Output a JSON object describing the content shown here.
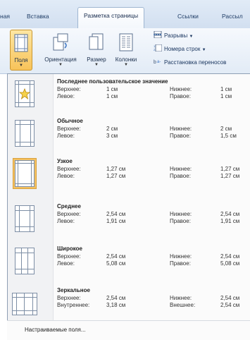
{
  "tabs": [
    "ная",
    "Вставка",
    "Разметка страницы",
    "Ссылки",
    "Рассыл"
  ],
  "ribbon": {
    "margins_label": "Поля",
    "orientation_label": "Ориентация",
    "size_label": "Размер",
    "columns_label": "Колонки",
    "breaks_label": "Разрывы",
    "line_numbers_label": "Номера строк",
    "hyphenation_label": "Расстановка переносов",
    "dropdown_arrow": "▼"
  },
  "margins_menu": {
    "options": [
      {
        "name": "Последнее пользовательское значение",
        "top_label": "Верхнее:",
        "top": "1 см",
        "bottom_label": "Нижнее:",
        "bottom": "1 см",
        "left_label": "Левое:",
        "left": "1 см",
        "right_label": "Правое:",
        "right": "1 см"
      },
      {
        "name": "Обычное",
        "top_label": "Верхнее:",
        "top": "2 см",
        "bottom_label": "Нижнее:",
        "bottom": "2 см",
        "left_label": "Левое:",
        "left": "3 см",
        "right_label": "Правое:",
        "right": "1,5 см"
      },
      {
        "name": "Узкое",
        "top_label": "Верхнее:",
        "top": "1,27 см",
        "bottom_label": "Нижнее:",
        "bottom": "1,27 см",
        "left_label": "Левое:",
        "left": "1,27 см",
        "right_label": "Правое:",
        "right": "1,27 см"
      },
      {
        "name": "Среднее",
        "top_label": "Верхнее:",
        "top": "2,54 см",
        "bottom_label": "Нижнее:",
        "bottom": "2,54 см",
        "left_label": "Левое:",
        "left": "1,91 см",
        "right_label": "Правое:",
        "right": "1,91 см"
      },
      {
        "name": "Широкое",
        "top_label": "Верхнее:",
        "top": "2,54 см",
        "bottom_label": "Нижнее:",
        "bottom": "2,54 см",
        "left_label": "Левое:",
        "left": "5,08 см",
        "right_label": "Правое:",
        "right": "5,08 см"
      },
      {
        "name": "Зеркальное",
        "top_label": "Верхнее:",
        "top": "2,54 см",
        "bottom_label": "Нижнее:",
        "bottom": "2,54 см",
        "left_label": "Внутреннее:",
        "left": "3,18 см",
        "right_label": "Внешнее:",
        "right": "2,54 см"
      }
    ],
    "custom_label": "Настраиваемые поля..."
  },
  "colors": {
    "active_button": "#f8c35a",
    "ribbon_bg": "#e2ebf6",
    "menu_bg": "#fbfbfb"
  }
}
